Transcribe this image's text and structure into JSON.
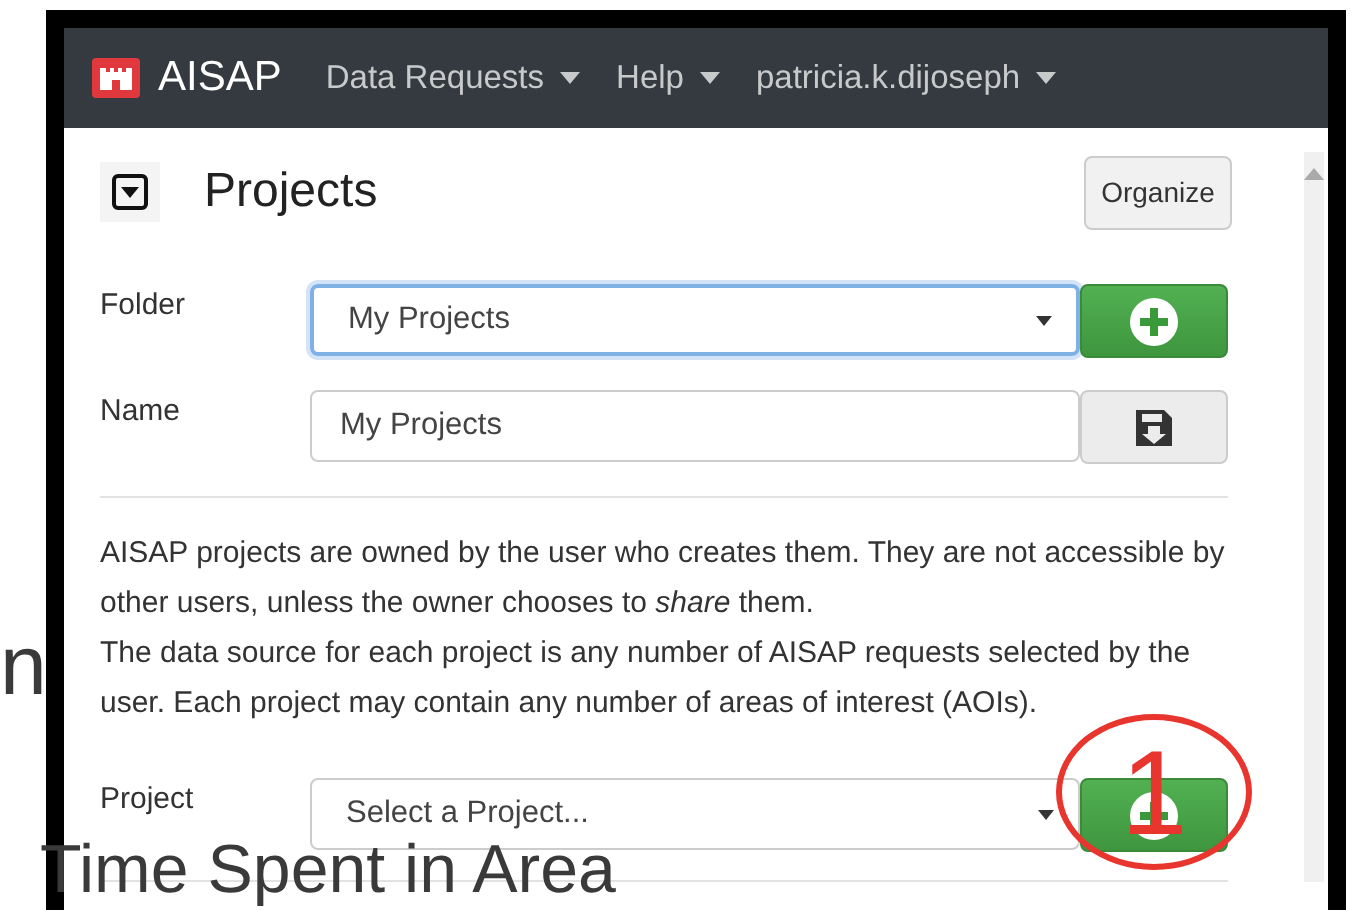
{
  "slide_text": [
    {
      "text": "n"
    },
    {
      "text": "Time Spent in Area"
    }
  ],
  "navbar": {
    "brand": "AISAP",
    "menus": [
      {
        "label": "Data Requests"
      },
      {
        "label": "Help"
      },
      {
        "label": "patricia.k.dijoseph"
      }
    ]
  },
  "panel": {
    "title": "Projects",
    "organize_button": "Organize",
    "folder": {
      "label": "Folder",
      "value": "My Projects",
      "focused": true
    },
    "name": {
      "label": "Name",
      "value": "My Projects"
    },
    "description": [
      "AISAP projects are owned by the user who creates them. They are not accessible by other users, unless the owner chooses to *share* them.",
      "The data source for each project is any number of AISAP requests selected by the user. Each project may contain any number of areas of interest (AOIs)."
    ],
    "project": {
      "label": "Project",
      "value": "Select a Project..."
    }
  },
  "annotation": {
    "number": "1"
  }
}
